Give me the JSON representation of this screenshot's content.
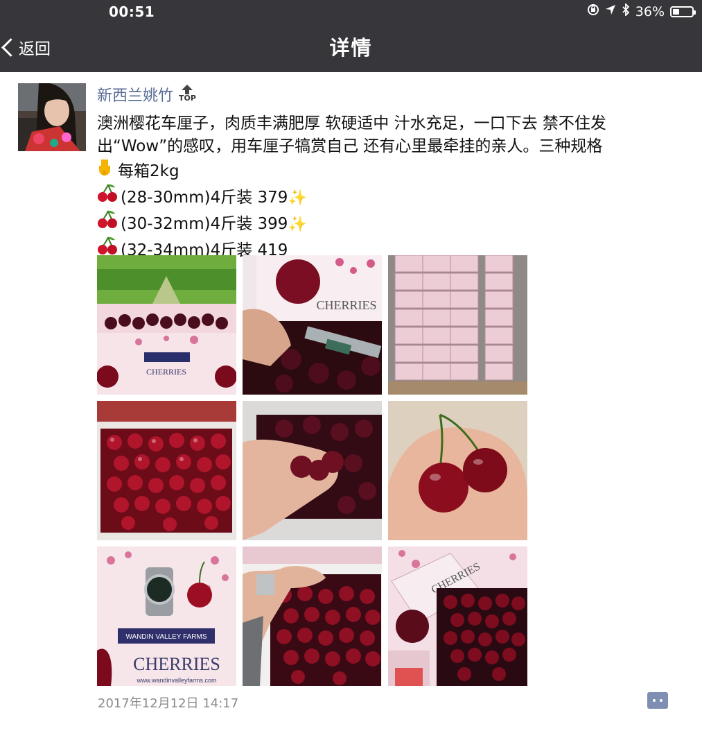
{
  "status_bar": {
    "time": "00:51",
    "battery_percent": "36%",
    "battery_level": 0.36,
    "icons": [
      "orientation-lock-icon",
      "location-arrow-icon",
      "bluetooth-icon",
      "battery-icon"
    ]
  },
  "nav": {
    "back_label": "返回",
    "title": "详情"
  },
  "post": {
    "author": "新西兰姚竹",
    "top_badge": "TOP",
    "lines": [
      "澳洲樱花车厘子，肉质丰满肥厚 软硬适中 汁水充足，一口下去 禁不住发",
      "出“Wow”的感叹，用车厘子犒赏自己 还有心里最牵挂的亲人。三种规格",
      "每箱2kg",
      "(28-30mm)4斤装 379",
      "(30-32mm)4斤装 399",
      "(32-34mm)4斤装 419"
    ],
    "photo_text": {
      "cherries_label": "CHERRIES",
      "farm_name": "WANDIN VALLEY FARMS",
      "farm_url": "www.wandinvalleyfarms.com"
    },
    "timestamp": "2017年12月12日 14:17"
  },
  "colors": {
    "nav_bg": "#37373b",
    "author_link": "#576b95",
    "timestamp": "#8a8a8a",
    "comment_button": "#7e8fb3",
    "cherry": "#8b0d1e"
  }
}
